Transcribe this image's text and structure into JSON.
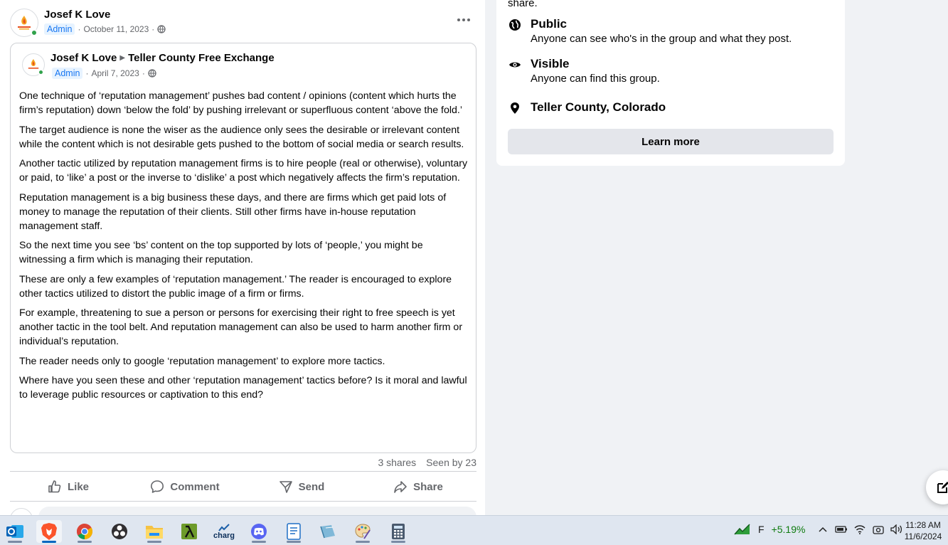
{
  "post": {
    "author": "Josef K Love",
    "badge": "Admin",
    "date": "October 11, 2023",
    "dot": "·",
    "shared": {
      "author": "Josef K Love",
      "group": "Teller County Free Exchange",
      "badge": "Admin",
      "date": "April 7, 2023",
      "dot": "·",
      "paragraphs": [
        "One technique of ‘reputation management’ pushes bad content / opinions (content which hurts the firm’s reputation) down ‘below the fold’ by pushing irrelevant or superfluous content ‘above the fold.’",
        "The target audience is none the wiser as the audience only sees the desirable or irrelevant content while the content which is not desirable gets pushed to the bottom of social media or search results.",
        "Another tactic utilized by reputation management firms is to hire people (real or otherwise), voluntary or paid, to ‘like’ a post or the inverse to ‘dislike’ a post which negatively affects the firm’s reputation.",
        "Reputation management is a big business these days, and there are firms which get paid lots of money to manage the reputation of their clients.  Still other firms have in-house reputation management staff.",
        "So the next time you see ‘bs’ content on the top supported by lots of ‘people,’ you might be witnessing a firm which is managing their reputation.",
        "These are only a few examples of ‘reputation management.’  The reader is encouraged to explore other tactics utilized to distort the public image of a firm or firms.",
        "For example, threatening to sue a person or persons for exercising their right to free speech is yet another tactic in the tool belt.  And reputation management can also be used to harm another firm or individual’s reputation.",
        "The reader needs only to google ‘reputation management’ to explore more tactics.",
        "Where have you seen these and other ‘reputation management’ tactics before?  Is it moral and lawful to leverage public resources or captivation to this end?"
      ]
    },
    "shares": "3 shares",
    "seen": "Seen by 23",
    "actions": {
      "like": "Like",
      "comment": "Comment",
      "send": "Send",
      "share": "Share"
    }
  },
  "about": {
    "cut_text": "share.",
    "privacy": {
      "title": "Public",
      "desc": "Anyone can see who's in the group and what they post."
    },
    "visibility": {
      "title": "Visible",
      "desc": "Anyone can find this group."
    },
    "location": "Teller County, Colorado",
    "learn_more": "Learn more"
  },
  "taskbar": {
    "apps": [
      "outlook-icon",
      "brave-icon",
      "chrome-icon",
      "obs-icon",
      "file-explorer-icon",
      "lambda-app-icon",
      "charg-app-icon",
      "discord-icon",
      "notepad-icon",
      "notebook-app-icon",
      "paint-icon",
      "calculator-icon"
    ],
    "charg_label": "charg",
    "stock": {
      "ticker": "F",
      "change": "+5.19%"
    },
    "time": "11:28 AM",
    "date": "11/6/2024"
  },
  "colors": {
    "accent": "#1877f2",
    "online": "#31a24c",
    "stock_up": "#0f7b0f"
  }
}
